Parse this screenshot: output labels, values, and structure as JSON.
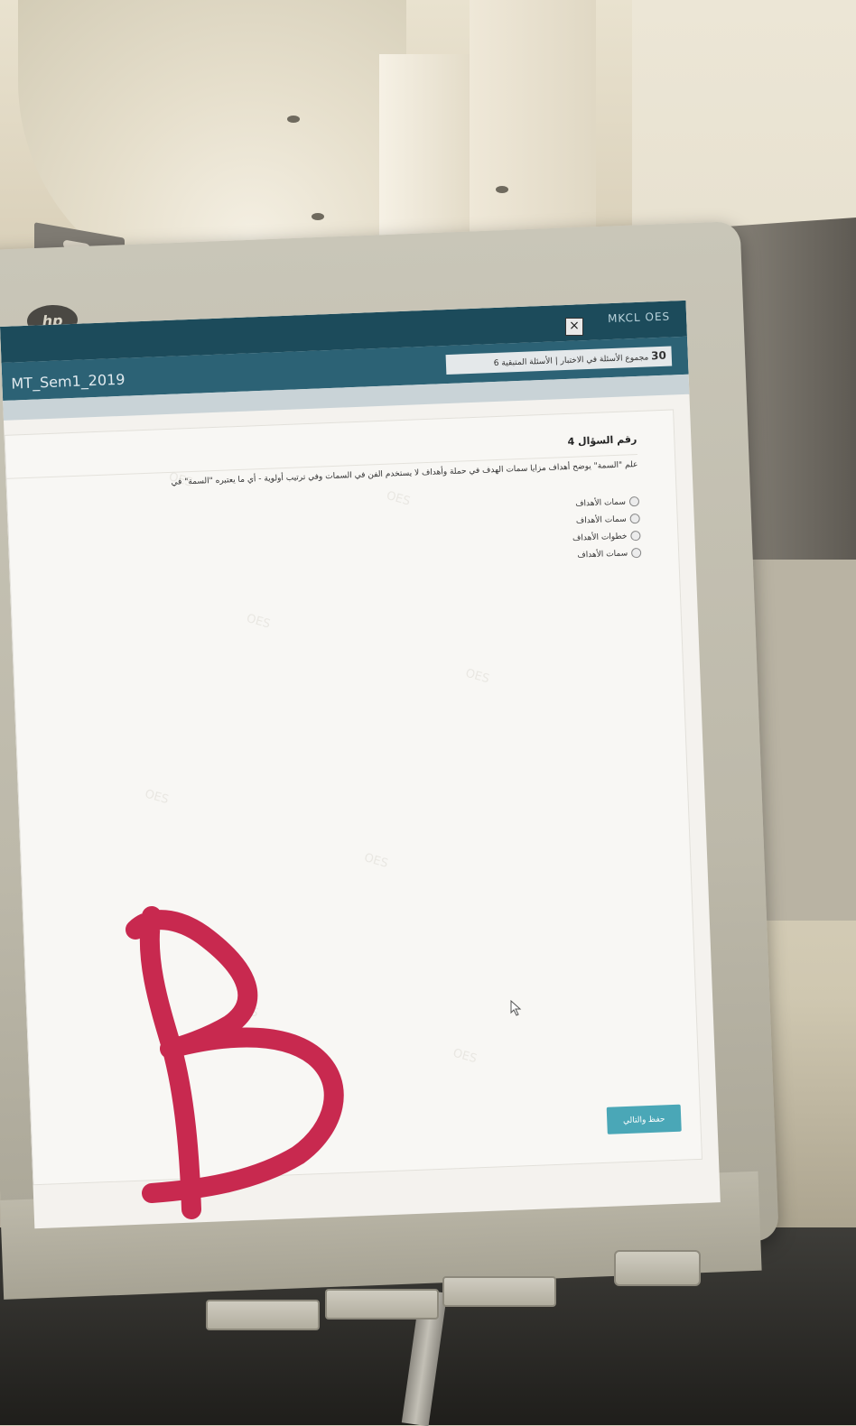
{
  "monitor": {
    "logo_text": "hp"
  },
  "window": {
    "close_glyph": "×",
    "brand": "MKCL OES",
    "exam_title": "MT_Sem1_2019",
    "breadcrumb": {
      "count": "30",
      "all_questions": "مجموع الأسئلة في الاختبار",
      "separator": "|",
      "answered": "الأسئلة المتبقية 6"
    }
  },
  "question": {
    "number_label": "رقم السؤال 4",
    "text": "علم \"السمة\" يوضح أهداف مزايا سمات الهدف في حملة وأهداف لا يستخدم الفن في السمات وفي ترتيب أولوية - أي ما يعتبره \"السمة\" في",
    "options": [
      "سمات الأهداف",
      "سمات الأهداف",
      "خطوات الأهداف",
      "سمات الأهداف"
    ],
    "watermark": "OES"
  },
  "actions": {
    "save_next_label": "حفظ والتالي"
  },
  "annotation": {
    "letter": "B",
    "color": "#c8294f"
  },
  "icons": {
    "close": "close-icon",
    "cursor": "mouse-pointer-icon",
    "radio": "radio-icon"
  }
}
